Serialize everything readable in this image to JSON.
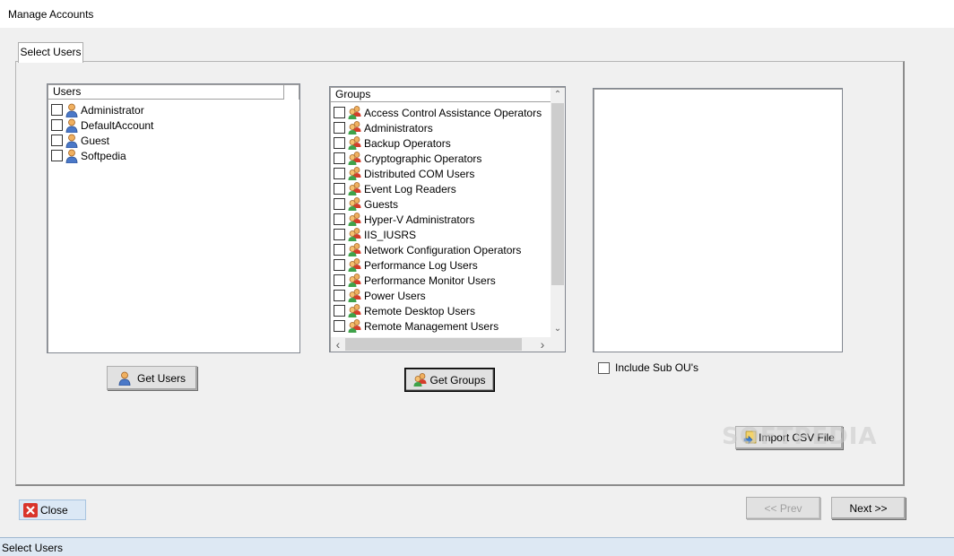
{
  "window": {
    "title": "Manage Accounts"
  },
  "tabs": [
    {
      "label": "Select Users"
    }
  ],
  "users_list": {
    "header": "Users",
    "items": [
      {
        "label": "Administrator"
      },
      {
        "label": "DefaultAccount"
      },
      {
        "label": "Guest"
      },
      {
        "label": "Softpedia"
      }
    ]
  },
  "groups_list": {
    "header": "Groups",
    "items": [
      {
        "label": "Access Control Assistance Operators"
      },
      {
        "label": "Administrators"
      },
      {
        "label": "Backup Operators"
      },
      {
        "label": "Cryptographic Operators"
      },
      {
        "label": "Distributed COM Users"
      },
      {
        "label": "Event Log Readers"
      },
      {
        "label": "Guests"
      },
      {
        "label": "Hyper-V Administrators"
      },
      {
        "label": "IIS_IUSRS"
      },
      {
        "label": "Network Configuration Operators"
      },
      {
        "label": "Performance Log Users"
      },
      {
        "label": "Performance Monitor Users"
      },
      {
        "label": "Power Users"
      },
      {
        "label": "Remote Desktop Users"
      },
      {
        "label": "Remote Management Users"
      }
    ]
  },
  "buttons": {
    "get_users": "Get Users",
    "get_groups": "Get Groups",
    "import_csv": "Import CSV File",
    "close": "Close",
    "prev": "<< Prev",
    "next": "Next >>"
  },
  "include_sub_ous": {
    "label": "Include Sub OU's",
    "checked": false
  },
  "watermark": "SOFTPEDIA",
  "status": {
    "text": "Select Users"
  },
  "colors": {
    "close_icon_red": "#d9342b",
    "status_bar": "#dde8f3"
  },
  "icons": {
    "user": "user-icon",
    "group": "group-icon",
    "close": "close-icon",
    "csv": "csv-import-icon"
  }
}
